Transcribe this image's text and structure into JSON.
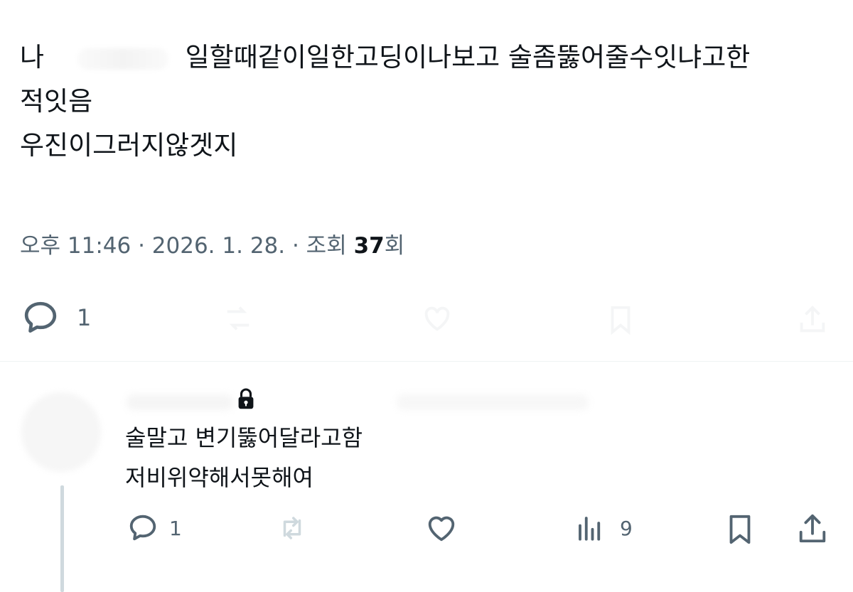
{
  "tweet": {
    "line1_start": "나",
    "line1_rest": "일할때같이일한고딩이나보고 술좀뚫어줄수잇냐고한",
    "line2": "적잇음",
    "line3": "우진이그러지않겟지",
    "meta_prefix": "오후 11:46 · 2026. 1. 28. · 조회 ",
    "views": "37",
    "meta_suffix": "회",
    "reply_count": "1"
  },
  "reply": {
    "line1": "술말고 변기뚫어달라고함",
    "line2": "저비위약해서못해여",
    "reply_count": "1",
    "view_count": "9"
  },
  "icons": {
    "reply": "comment-bubble-icon",
    "retweet": "retweet-icon",
    "like": "heart-icon",
    "views": "bar-chart-icon",
    "bookmark": "bookmark-icon",
    "share": "share-upload-icon",
    "lock": "lock-icon"
  },
  "colors": {
    "text": "#0f1419",
    "muted": "#536471",
    "faded_icon": "#e1e8ed",
    "divider": "#eff3f4"
  }
}
